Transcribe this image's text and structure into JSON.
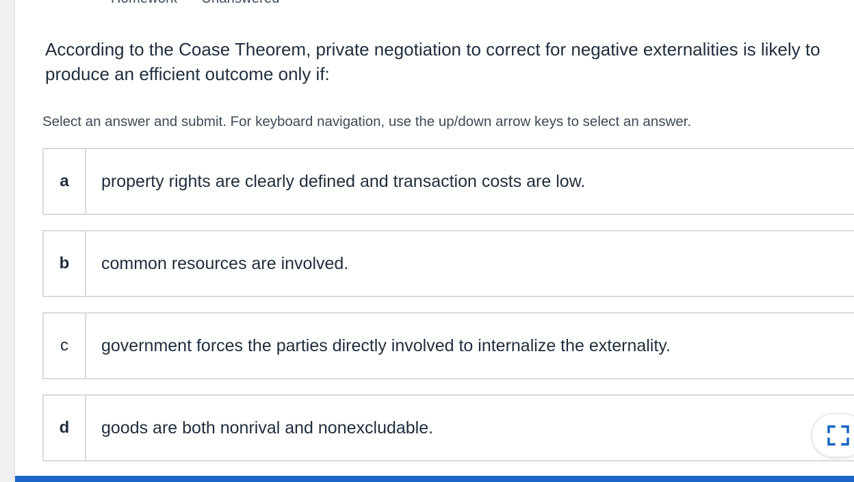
{
  "header": {
    "category": "Homework",
    "status": "Unanswered"
  },
  "question": {
    "text": "According to the Coase Theorem, private negotiation to correct for negative externalities is likely to produce an efficient outcome only if:"
  },
  "instructions": "Select an answer and submit. For keyboard navigation, use the up/down arrow keys to select an answer.",
  "answers": [
    {
      "letter": "a",
      "text": "property rights are clearly defined and transaction costs are low."
    },
    {
      "letter": "b",
      "text": "common resources are involved."
    },
    {
      "letter": "c",
      "text": "government forces the parties directly involved to internalize the externality."
    },
    {
      "letter": "d",
      "text": "goods are both nonrival and nonexcludable."
    }
  ],
  "controls": {
    "expand_icon": "expand-icon"
  },
  "colors": {
    "accent_bar": "#1b64c8",
    "border": "#d7dbdf",
    "icon": "#1b64c8"
  }
}
